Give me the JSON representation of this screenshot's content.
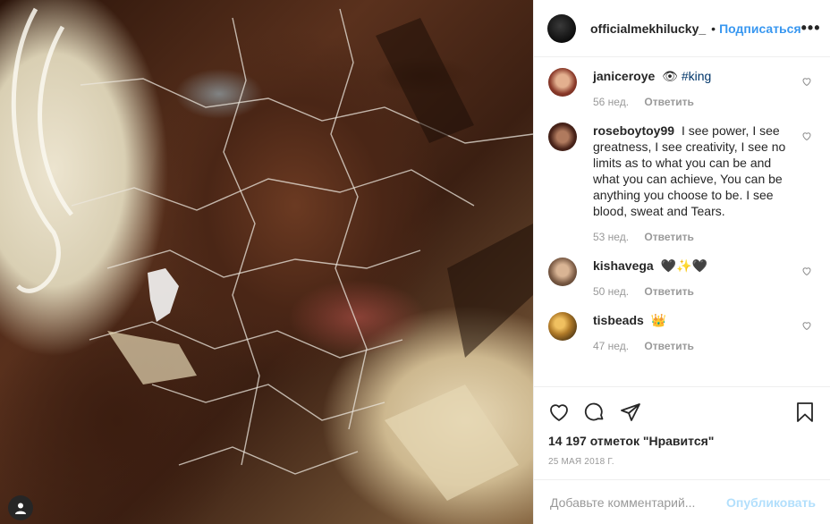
{
  "post": {
    "username": "officialmekhilucky_",
    "separator": "•",
    "follow_label": "Подписаться",
    "more_label": "•••"
  },
  "comments": [
    {
      "username": "janiceroye",
      "text": "👁 ",
      "hashtag": "#king",
      "time": "56 нед.",
      "reply": "Ответить",
      "avatar_color": "#b0624a"
    },
    {
      "username": "roseboytoy99",
      "text": "I see power, I see greatness, I see creativity, I see no limits as to what you can be and what you can achieve, You can be anything you choose to be. I see blood, sweat and Tears.",
      "hashtag": "",
      "time": "53 нед.",
      "reply": "Ответить",
      "avatar_color": "#5a2e22"
    },
    {
      "username": "kishavega",
      "text": "🖤✨🖤",
      "hashtag": "",
      "time": "50 нед.",
      "reply": "Ответить",
      "avatar_color": "#8a6a50"
    },
    {
      "username": "tisbeads",
      "text": "👑",
      "hashtag": "",
      "time": "47 нед.",
      "reply": "Ответить",
      "avatar_color": "#9a7a30"
    }
  ],
  "footer": {
    "likes": "14 197 отметок \"Нравится\"",
    "date": "25 МАЯ 2018 Г.",
    "comment_placeholder": "Добавьте комментарий...",
    "post_label": "Опубликовать"
  },
  "icons": {
    "like": "heart-icon",
    "comment": "comment-icon",
    "share": "share-icon",
    "save": "bookmark-icon",
    "tagged": "user-icon"
  },
  "colors": {
    "link": "#3897f0",
    "post_disabled": "#b2dffc",
    "muted": "#999999",
    "text": "#262626"
  }
}
